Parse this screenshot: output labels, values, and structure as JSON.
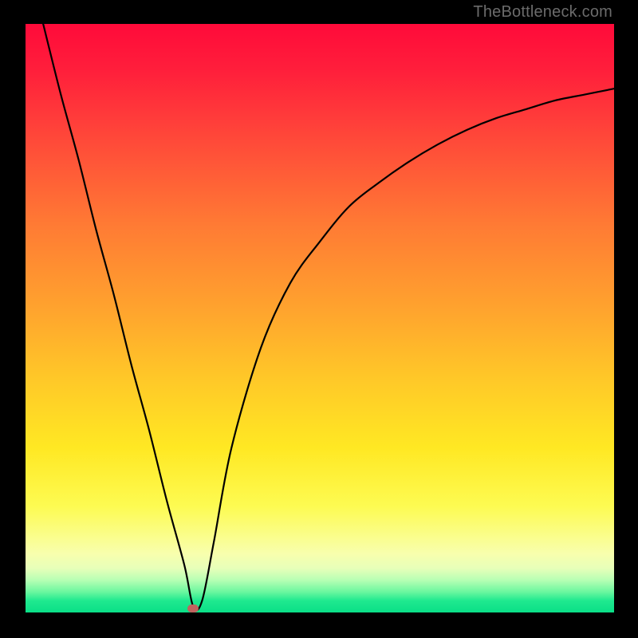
{
  "watermark": "TheBottleneck.com",
  "chart_data": {
    "type": "line",
    "title": "",
    "xlabel": "",
    "ylabel": "",
    "xlim": [
      0,
      100
    ],
    "ylim": [
      0,
      100
    ],
    "grid": false,
    "legend": false,
    "gradient": {
      "orientation": "vertical",
      "stops": [
        {
          "pos": 0.0,
          "color": "#ff0a3a"
        },
        {
          "pos": 0.2,
          "color": "#ff4a39"
        },
        {
          "pos": 0.48,
          "color": "#ffa22e"
        },
        {
          "pos": 0.72,
          "color": "#ffe823"
        },
        {
          "pos": 0.9,
          "color": "#f8ffad"
        },
        {
          "pos": 0.96,
          "color": "#6bf79f"
        },
        {
          "pos": 1.0,
          "color": "#0adf87"
        }
      ]
    },
    "series": [
      {
        "name": "bottleneck-curve",
        "color": "#000000",
        "x": [
          3,
          6,
          9,
          12,
          15,
          18,
          21,
          24,
          27,
          28.5,
          30,
          32,
          35,
          40,
          45,
          50,
          55,
          60,
          65,
          70,
          75,
          80,
          85,
          90,
          95,
          100
        ],
        "y": [
          100,
          88,
          77,
          65,
          54,
          42,
          31,
          19,
          8,
          1,
          2,
          12,
          28,
          45,
          56,
          63,
          69,
          73,
          76.5,
          79.5,
          82,
          84,
          85.5,
          87,
          88,
          89
        ]
      }
    ],
    "marker": {
      "x": 28.5,
      "y": 0.7,
      "color": "#c1635f"
    }
  }
}
